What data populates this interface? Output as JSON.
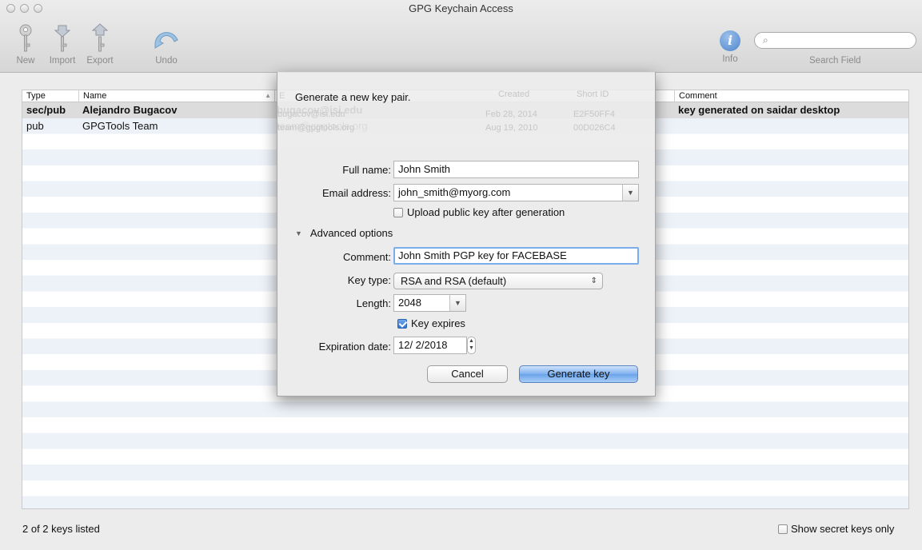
{
  "window": {
    "title": "GPG Keychain Access",
    "traffic_lights": [
      "close",
      "minimize",
      "zoom"
    ]
  },
  "toolbar": {
    "new_label": "New",
    "import_label": "Import",
    "export_label": "Export",
    "undo_label": "Undo",
    "info_label": "Info",
    "info_glyph": "i",
    "search_icon_glyph": "⌕",
    "search_label": "Search Field",
    "search_value": ""
  },
  "table": {
    "columns": [
      "Type",
      "Name",
      "Email",
      "Created",
      "Short ID",
      "Comment"
    ],
    "sort_indicator": "▲",
    "email_col_letter": "E",
    "rows": [
      {
        "type": "sec/pub",
        "name": "Alejandro Bugacov",
        "email": "bugacov@isi.edu",
        "created": "Feb 28, 2014",
        "short_id": "E2F50FF4",
        "comment": "key generated on saidar desktop",
        "selected": true
      },
      {
        "type": "pub",
        "name": "GPGTools Team",
        "email": "team@gpgtools.org",
        "created": "Aug 19, 2010",
        "short_id": "00D026C4",
        "comment": "",
        "selected": false
      }
    ]
  },
  "status": {
    "count_text": "2 of 2 keys listed",
    "show_secret_label": "Show secret keys only",
    "show_secret_checked": false
  },
  "sheet": {
    "title": "Generate a new key pair.",
    "full_name_label": "Full name:",
    "full_name_value": "John Smith",
    "email_label": "Email address:",
    "email_value": "john_smith@myorg.com",
    "upload_label": "Upload public key after generation",
    "upload_checked": false,
    "advanced_label": "Advanced options",
    "advanced_expanded": true,
    "comment_label": "Comment:",
    "comment_value": "John Smith PGP key for FACEBASE",
    "key_type_label": "Key type:",
    "key_type_value": "RSA and RSA (default)",
    "length_label": "Length:",
    "length_value": "2048",
    "expires_label": "Key expires",
    "expires_checked": true,
    "expiration_label": "Expiration date:",
    "expiration_value": "12/  2/2018",
    "cancel_label": "Cancel",
    "generate_label": "Generate key"
  },
  "colors": {
    "accent": "#6aa3ea",
    "focus_ring": "#7cadeb",
    "stripe": "#edf2f8",
    "selected_row": "#dcdcdc"
  }
}
